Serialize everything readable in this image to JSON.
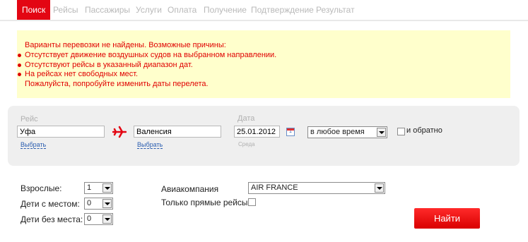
{
  "tabs": [
    "Поиск",
    "Рейсы",
    "Пассажиры",
    "Услуги",
    "Оплата",
    "Получение",
    "Подтверждение",
    "Результат"
  ],
  "error": {
    "title": "Варианты перевозки не найдены. Возможные причины:",
    "reasons": [
      "Отсутствует движение воздушных судов на выбранном направлении.",
      "Отсутствуют рейсы в указанный диапазон дат.",
      "На рейсах нет свободных мест."
    ],
    "footer": "Пожалуйста, попробуйте изменить даты перелета."
  },
  "search": {
    "route_label": "Рейс",
    "from": "Уфа",
    "to": "Валенсия",
    "choose_link": "Выбрать",
    "date_label": "Дата",
    "date": "25.01.2012",
    "weekday": "Среда",
    "time": "в любое время",
    "return_label": "и обратно",
    "calendar_day": "1"
  },
  "passengers": {
    "adults_label": "Взрослые:",
    "adults": "1",
    "children_seat_label": "Дети с местом:",
    "children_seat": "0",
    "children_noseat_label": "Дети без места:",
    "children_noseat": "0"
  },
  "airline": {
    "label": "Авиакомпания",
    "value": "AIR FRANCE",
    "direct_label": "Только прямые рейсы"
  },
  "submit_label": "Найти",
  "colors": {
    "accent": "#e30613",
    "warning_bg": "#ffffcc",
    "error_text": "#e00000"
  }
}
